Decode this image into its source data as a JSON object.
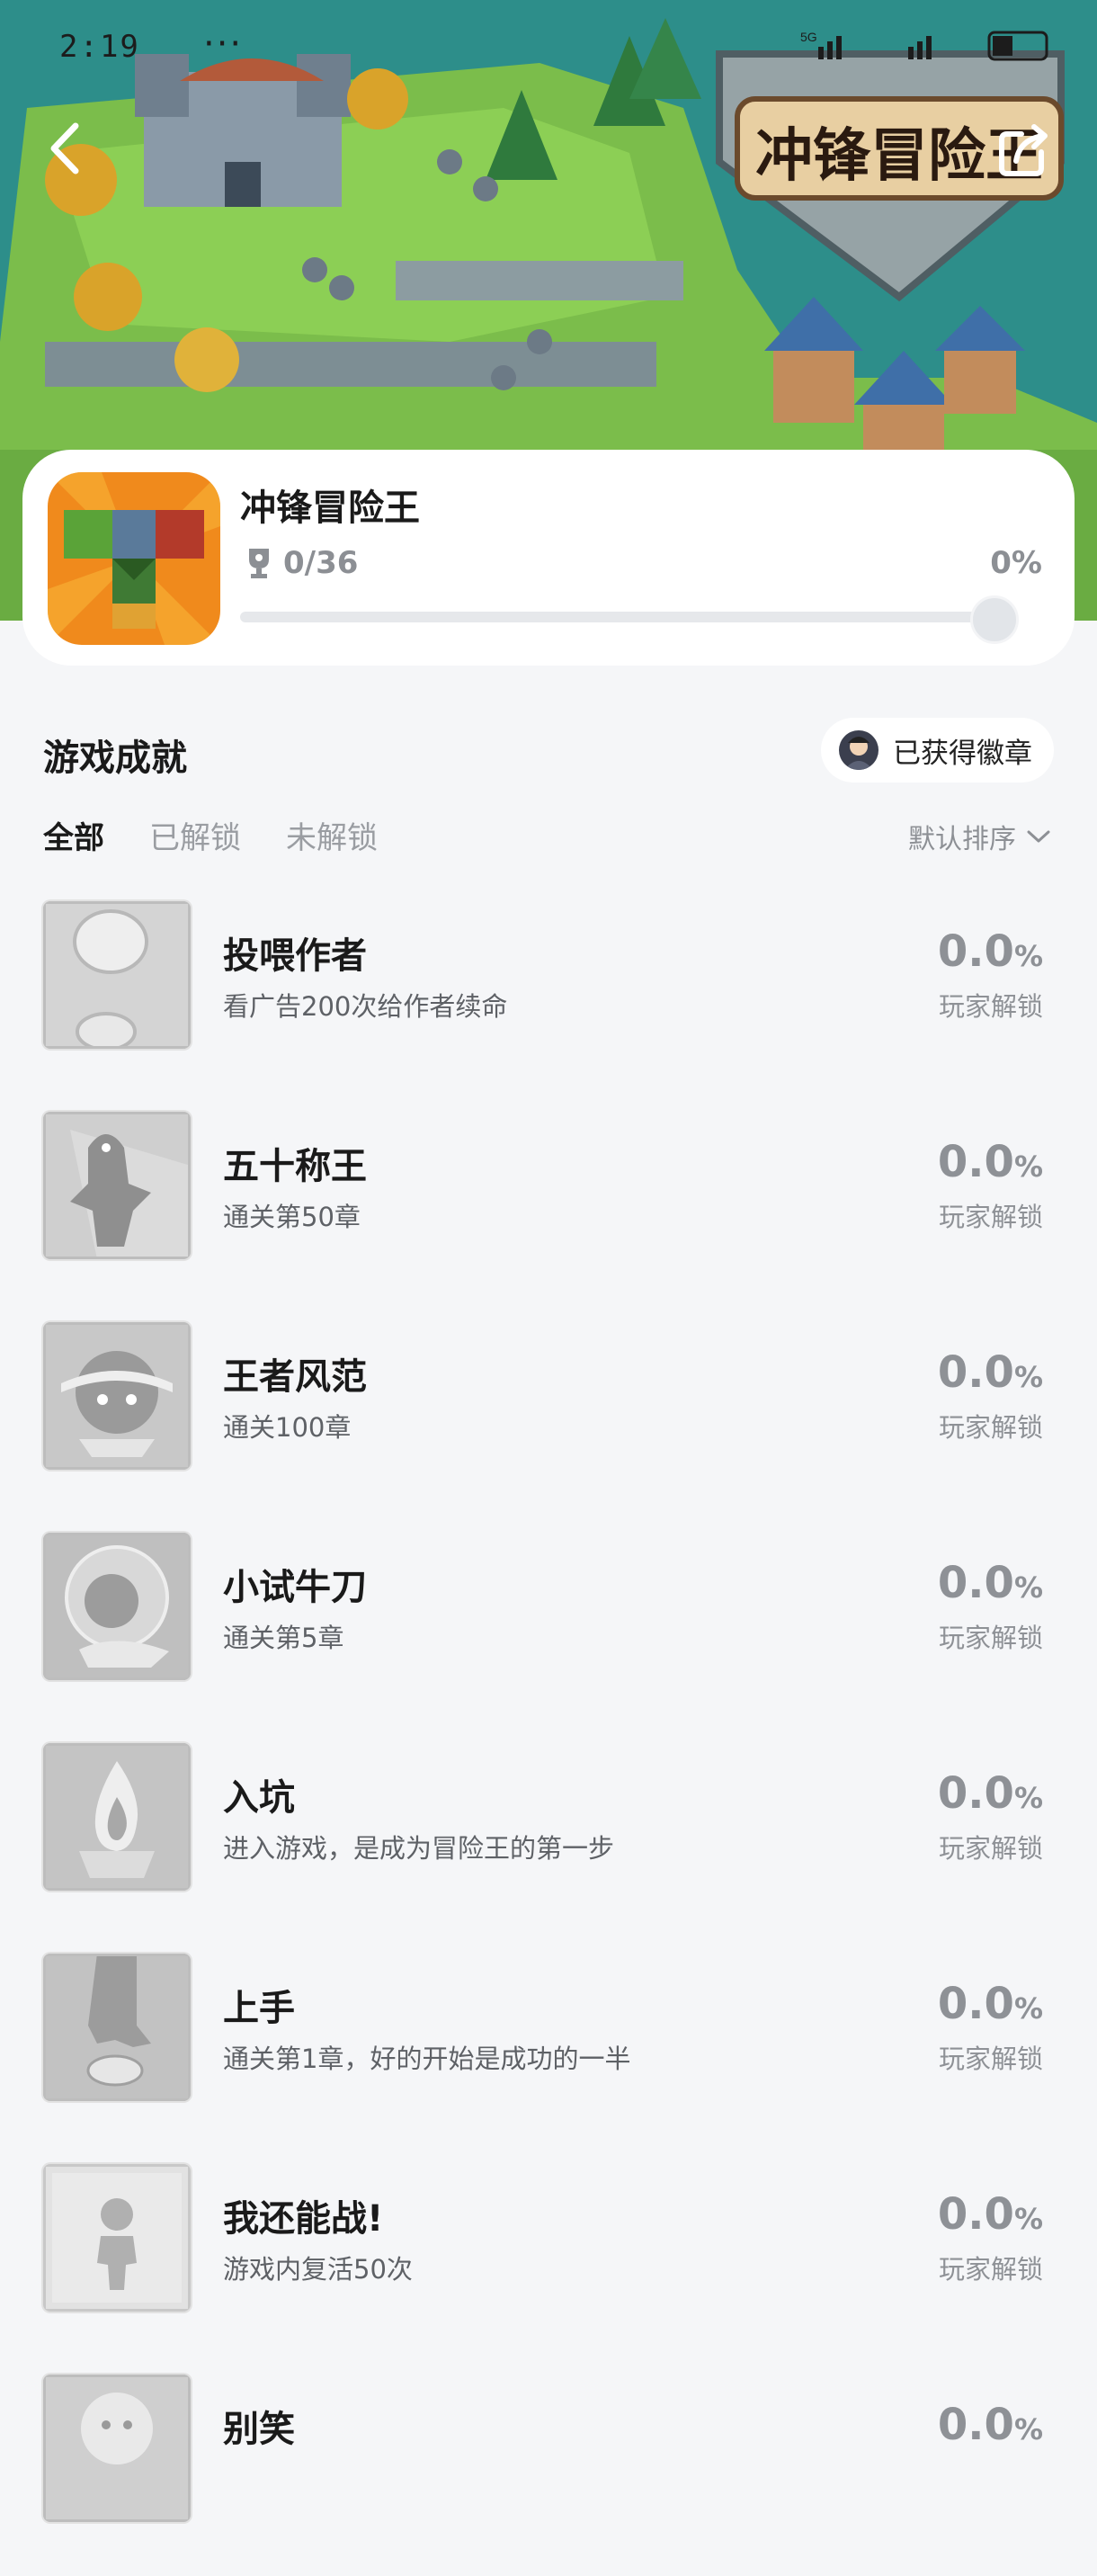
{
  "status_bar": {
    "time": "2:19",
    "dots": "···",
    "network": "5G"
  },
  "banner": {
    "logo_text": "冲锋冒险王"
  },
  "game": {
    "title": "冲锋冒险王",
    "trophy_count": "0/36",
    "percent": "0%",
    "progress": 0
  },
  "section": {
    "title": "游戏成就",
    "badge_button": "已获得徽章"
  },
  "filters": {
    "all": "全部",
    "unlocked": "已解锁",
    "locked": "未解锁",
    "sort": "默认排序"
  },
  "achievements": [
    {
      "name": "投喂作者",
      "desc": "看广告200次给作者续命",
      "rate": "0.0",
      "pct": "%",
      "unlock": "玩家解锁",
      "icon": "coins-icon"
    },
    {
      "name": "五十称王",
      "desc": "通关第50章",
      "rate": "0.0",
      "pct": "%",
      "unlock": "玩家解锁",
      "icon": "dino-icon"
    },
    {
      "name": "王者风范",
      "desc": "通关100章",
      "rate": "0.0",
      "pct": "%",
      "unlock": "玩家解锁",
      "icon": "crown-face-icon"
    },
    {
      "name": "小试牛刀",
      "desc": "通关第5章",
      "rate": "0.0",
      "pct": "%",
      "unlock": "玩家解锁",
      "icon": "bubble-head-icon"
    },
    {
      "name": "入坑",
      "desc": "进入游戏，是成为冒险王的第一步",
      "rate": "0.0",
      "pct": "%",
      "unlock": "玩家解锁",
      "icon": "flame-icon"
    },
    {
      "name": "上手",
      "desc": "通关第1章，好的开始是成功的一半",
      "rate": "0.0",
      "pct": "%",
      "unlock": "玩家解锁",
      "icon": "hand-icon"
    },
    {
      "name": "我还能战!",
      "desc": "游戏内复活50次",
      "rate": "0.0",
      "pct": "%",
      "unlock": "玩家解锁",
      "icon": "figure-icon"
    },
    {
      "name": "别笑",
      "desc": "",
      "rate": "0.0",
      "pct": "%",
      "unlock": "",
      "icon": "smile-icon"
    }
  ]
}
